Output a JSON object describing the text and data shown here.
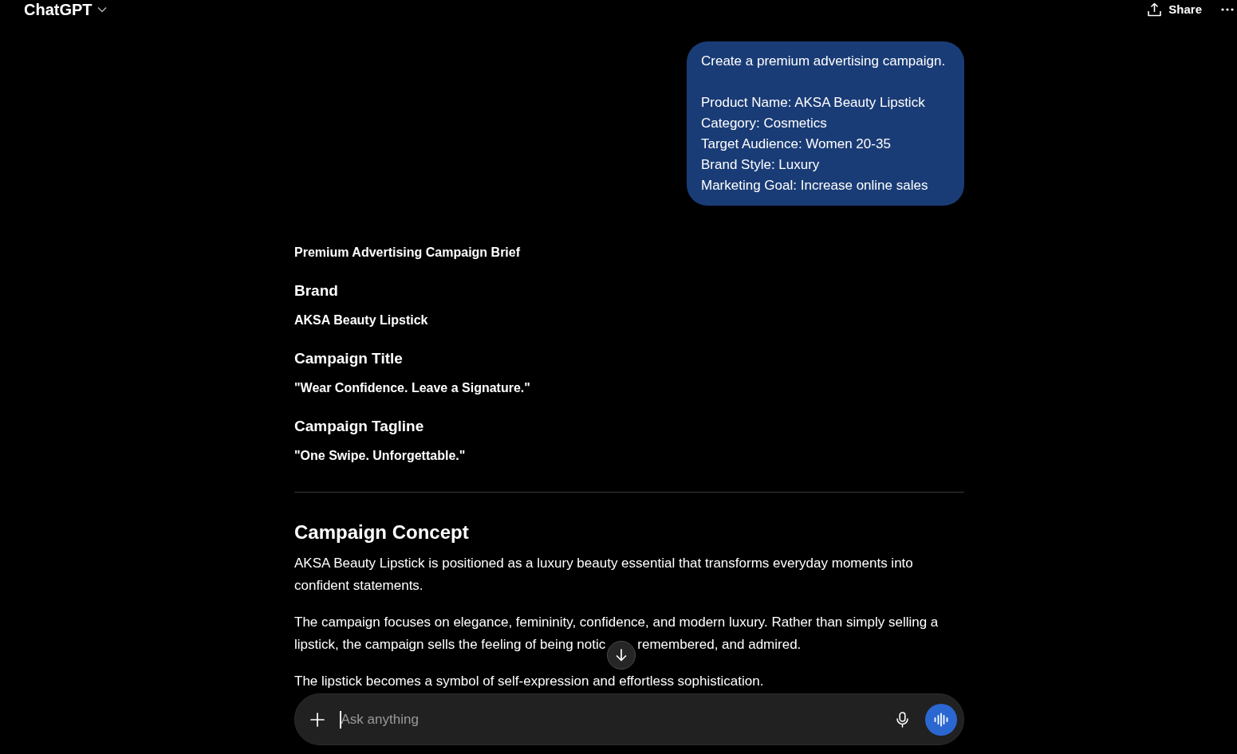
{
  "header": {
    "model_label": "ChatGPT",
    "share_label": "Share"
  },
  "user_message": {
    "intro": "Create a premium advertising campaign.",
    "lines": [
      "Product Name: AKSA Beauty Lipstick",
      "Category: Cosmetics",
      "Target Audience: Women 20-35",
      "Brand Style: Luxury",
      "Marketing Goal: Increase online sales"
    ]
  },
  "response": [
    {
      "kind": "title",
      "text": "Premium Advertising Campaign Brief"
    },
    {
      "kind": "h3",
      "text": "Brand"
    },
    {
      "kind": "strong",
      "text": "AKSA Beauty Lipstick"
    },
    {
      "kind": "h3",
      "text": "Campaign Title"
    },
    {
      "kind": "strong",
      "text": "\"Wear Confidence. Leave a Signature.\""
    },
    {
      "kind": "h3",
      "text": "Campaign Tagline"
    },
    {
      "kind": "strong",
      "text": "\"One Swipe. Unforgettable.\""
    },
    {
      "kind": "rule"
    },
    {
      "kind": "h2",
      "text": "Campaign Concept"
    },
    {
      "kind": "paragraph",
      "text": "AKSA Beauty Lipstick is positioned as a luxury beauty essential that transforms everyday moments into confident statements."
    },
    {
      "kind": "paragraph",
      "parts": [
        "The campaign focuses on elegance, femininity, confidence, and modern luxury. Rather than simply selling a",
        "lipstick, the campaign sells the feeling of being notic",
        "remembered, and admired."
      ]
    },
    {
      "kind": "paragraph",
      "text": "The lipstick becomes a symbol of self-expression and effortless sophistication."
    }
  ],
  "composer": {
    "placeholder": "Ask anything"
  }
}
